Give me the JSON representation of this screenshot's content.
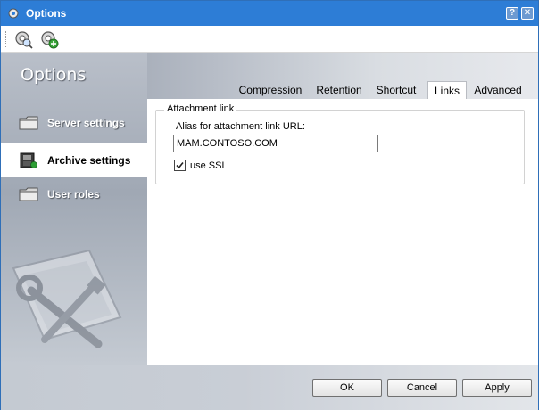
{
  "window": {
    "title": "Options",
    "help_button": "?",
    "close_button": "✕"
  },
  "toolbar": {
    "tools": [
      {
        "icon": "settings-search-icon"
      },
      {
        "icon": "settings-add-icon"
      }
    ]
  },
  "sidebar": {
    "title": "Options",
    "items": [
      {
        "label": "Server settings",
        "icon": "folder-icon",
        "active": false
      },
      {
        "label": "Archive settings",
        "icon": "archive-drive-icon",
        "active": true
      },
      {
        "label": "User roles",
        "icon": "folder-icon",
        "active": false
      }
    ]
  },
  "tabs": [
    {
      "label": "Compression",
      "active": false
    },
    {
      "label": "Retention",
      "active": false
    },
    {
      "label": "Shortcut",
      "active": false
    },
    {
      "label": "Links",
      "active": true
    },
    {
      "label": "Advanced",
      "active": false
    }
  ],
  "attachment_link": {
    "legend": "Attachment link",
    "alias_label": "Alias for attachment link URL:",
    "alias_value": "MAM.CONTOSO.COM",
    "use_ssl_label": "use SSL",
    "use_ssl_checked": true
  },
  "footer": {
    "ok_label": "OK",
    "cancel_label": "Cancel",
    "apply_label": "Apply"
  },
  "colors": {
    "titlebar": "#2d7dd6",
    "sidebar_gray": "#a0a8b4"
  }
}
